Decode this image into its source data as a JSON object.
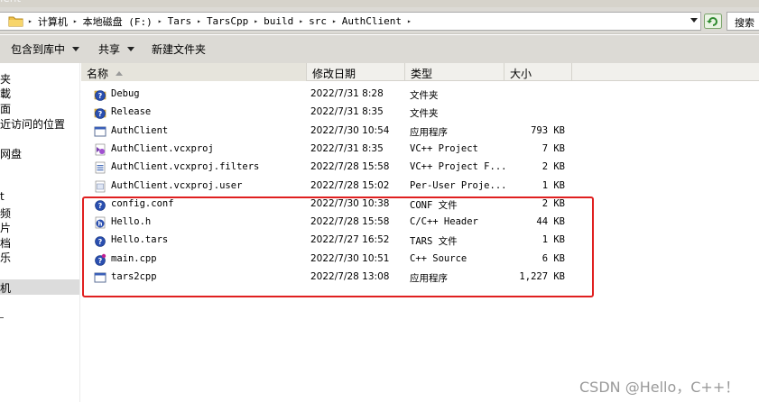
{
  "window": {
    "title_fragment": "ient"
  },
  "address_bar": {
    "crumbs": [
      "计算机",
      "本地磁盘 (F:)",
      "Tars",
      "TarsCpp",
      "build",
      "src",
      "AuthClient"
    ],
    "search_placeholder": "搜索"
  },
  "toolbar": {
    "include_library_label": "包含到库中",
    "share_label": "共享",
    "new_folder_label": "新建文件夹"
  },
  "nav": {
    "items": [
      "夹",
      "載",
      "面",
      "近访问的位置",
      "网盘",
      "t",
      "频",
      "片",
      "档",
      "乐",
      "机"
    ],
    "selected_index": 10
  },
  "columns": {
    "name": "名称",
    "date": "修改日期",
    "type": "类型",
    "size": "大小"
  },
  "files": [
    {
      "name": "Debug",
      "date": "2022/7/31 8:28",
      "type": "文件夹",
      "size": "",
      "icon": "folder-icon"
    },
    {
      "name": "Release",
      "date": "2022/7/31 8:35",
      "type": "文件夹",
      "size": "",
      "icon": "folder-icon"
    },
    {
      "name": "AuthClient",
      "date": "2022/7/30 10:54",
      "type": "应用程序",
      "size": "793 KB",
      "icon": "application-icon"
    },
    {
      "name": "AuthClient.vcxproj",
      "date": "2022/7/31 8:35",
      "type": "VC++ Project",
      "size": "7 KB",
      "icon": "vcxproj-icon"
    },
    {
      "name": "AuthClient.vcxproj.filters",
      "date": "2022/7/28 15:58",
      "type": "VC++ Project F...",
      "size": "2 KB",
      "icon": "filters-icon"
    },
    {
      "name": "AuthClient.vcxproj.user",
      "date": "2022/7/28 15:02",
      "type": "Per-User Proje...",
      "size": "1 KB",
      "icon": "user-file-icon"
    },
    {
      "name": "config.conf",
      "date": "2022/7/30 10:38",
      "type": "CONF 文件",
      "size": "2 KB",
      "icon": "conf-file-icon"
    },
    {
      "name": "Hello.h",
      "date": "2022/7/28 15:58",
      "type": "C/C++ Header",
      "size": "44 KB",
      "icon": "header-file-icon"
    },
    {
      "name": "Hello.tars",
      "date": "2022/7/27 16:52",
      "type": "TARS 文件",
      "size": "1 KB",
      "icon": "tars-file-icon"
    },
    {
      "name": "main.cpp",
      "date": "2022/7/30 10:51",
      "type": "C++ Source",
      "size": "6 KB",
      "icon": "cpp-file-icon"
    },
    {
      "name": "tars2cpp",
      "date": "2022/7/28 13:08",
      "type": "应用程序",
      "size": "1,227 KB",
      "icon": "application-icon"
    }
  ],
  "highlight_color": "#e02020",
  "watermark": "CSDN @Hello，C++！"
}
